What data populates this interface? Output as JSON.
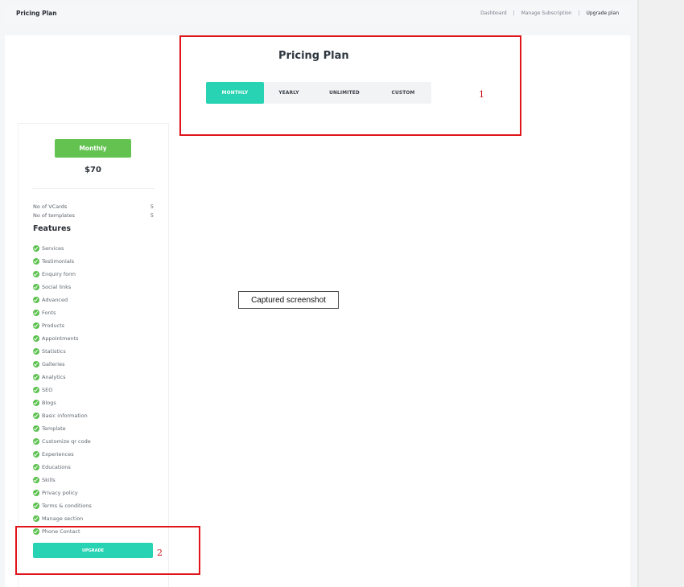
{
  "header": {
    "title": "Pricing Plan",
    "breadcrumb": [
      "Dashboard",
      "Manage Subscription",
      "Upgrade plan"
    ],
    "separator": "|"
  },
  "main": {
    "title": "Pricing Plan",
    "tabs": [
      {
        "label": "MONTHLY",
        "active": true
      },
      {
        "label": "YEARLY",
        "active": false
      },
      {
        "label": "UNLIMITED",
        "active": false
      },
      {
        "label": "CUSTOM",
        "active": false
      }
    ]
  },
  "plan_card": {
    "name": "Monthly",
    "price": "$70",
    "stats": [
      {
        "label": "No of VCards",
        "value": "5"
      },
      {
        "label": "No of templates",
        "value": "5"
      }
    ],
    "features_heading": "Features",
    "features": [
      "Services",
      "Testimonials",
      "Enquiry form",
      "Social links",
      "Advanced",
      "Fonts",
      "Products",
      "Appointments",
      "Statistics",
      "Galleries",
      "Analytics",
      "SEO",
      "Blogs",
      "Basic information",
      "Template",
      "Customize qr code",
      "Experiences",
      "Educations",
      "Skills",
      "Privacy policy",
      "Terms & conditions",
      "Manage section",
      "Phone Contact"
    ],
    "upgrade_label": "UPGRADE"
  },
  "annotations": {
    "label_1": "1",
    "label_2": "2"
  },
  "caption": "Captured screenshot",
  "colors": {
    "accent": "#28d3b3",
    "plan_badge": "#63c250",
    "check": "#5cc14f",
    "annotation": "#e0141b"
  }
}
